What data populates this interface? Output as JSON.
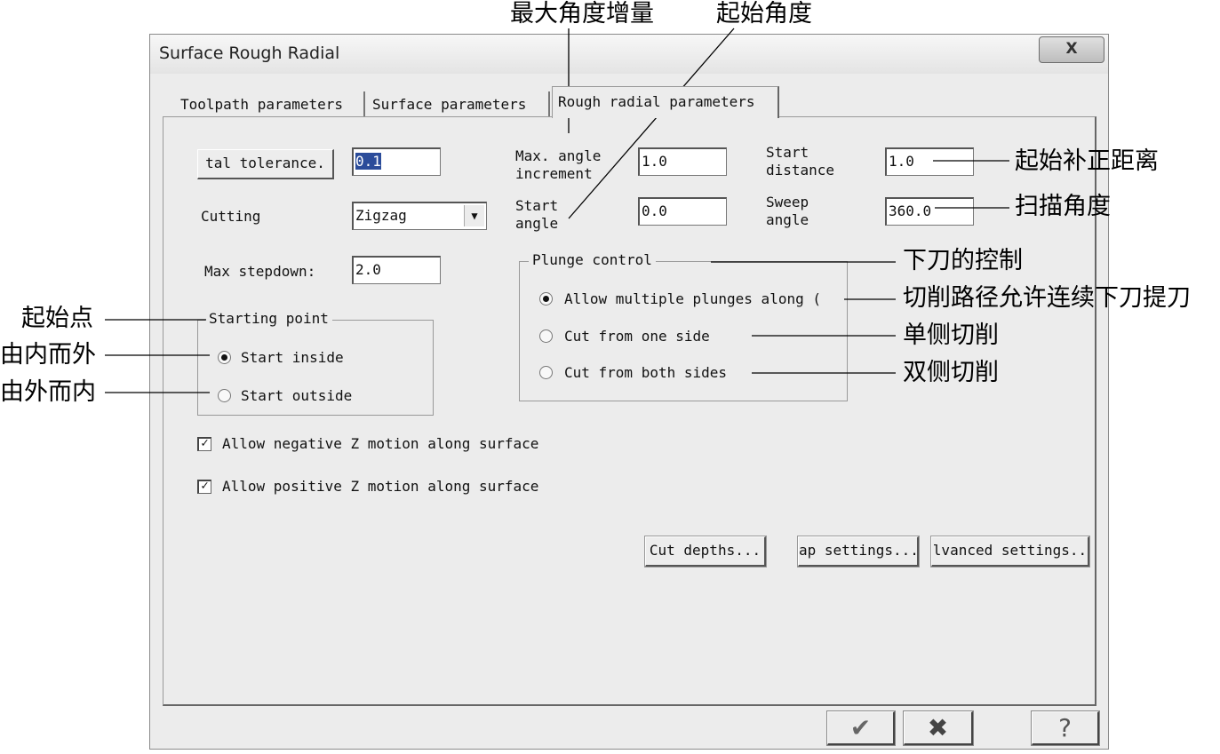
{
  "window": {
    "title": "Surface Rough Radial",
    "close_icon": "x-icon",
    "close_label": "X"
  },
  "tabs": [
    {
      "label": "Toolpath parameters"
    },
    {
      "label": "Surface parameters"
    },
    {
      "label": "Rough radial parameters"
    }
  ],
  "form": {
    "total_tolerance_button": "tal tolerance.",
    "total_tolerance_value": "0.1",
    "cutting_label": "Cutting",
    "cutting_value": "Zigzag",
    "max_stepdown_label": "Max stepdown:",
    "max_stepdown_value": "2.0",
    "max_angle_label_1": "Max. angle",
    "max_angle_label_2": "increment",
    "max_angle_value": "1.0",
    "start_angle_label_1": "Start",
    "start_angle_label_2": "angle",
    "start_angle_value": "0.0",
    "start_distance_label_1": "Start",
    "start_distance_label_2": "distance",
    "start_distance_value": "1.0",
    "sweep_angle_label_1": "Sweep",
    "sweep_angle_label_2": "angle",
    "sweep_angle_value": "360.0"
  },
  "starting_point": {
    "title": "Starting point",
    "options": [
      {
        "label": "Start inside",
        "selected": true
      },
      {
        "label": "Start outside",
        "selected": false
      }
    ]
  },
  "plunge_control": {
    "title": "Plunge control",
    "options": [
      {
        "label": "Allow multiple plunges along (",
        "selected": true
      },
      {
        "label": "Cut from one side",
        "selected": false
      },
      {
        "label": "Cut from both sides",
        "selected": false
      }
    ]
  },
  "checkboxes": [
    {
      "label": "Allow negative Z motion along surface",
      "checked": true
    },
    {
      "label": "Allow positive Z motion along surface",
      "checked": true
    }
  ],
  "action_buttons": {
    "cut_depths": "Cut depths...",
    "gap_settings": "ap settings...",
    "advanced_settings": "lvanced settings.."
  },
  "footer_buttons": {
    "ok_icon": "checkmark-icon",
    "ok_glyph": "✔",
    "cancel_icon": "cross-icon",
    "cancel_glyph": "✖",
    "help_icon": "help-icon",
    "help_glyph": "?"
  },
  "annotations": {
    "max_angle_increment": "最大角度增量",
    "start_angle": "起始角度",
    "start_distance": "起始补正距离",
    "sweep_angle": "扫描角度",
    "plunge_control": "下刀的控制",
    "multiple_plunges": "切削路径允许连续下刀提刀",
    "one_side": "单侧切削",
    "both_sides": "双侧切削",
    "starting_point": "起始点",
    "start_inside": "由内而外",
    "start_outside": "由外而内"
  }
}
